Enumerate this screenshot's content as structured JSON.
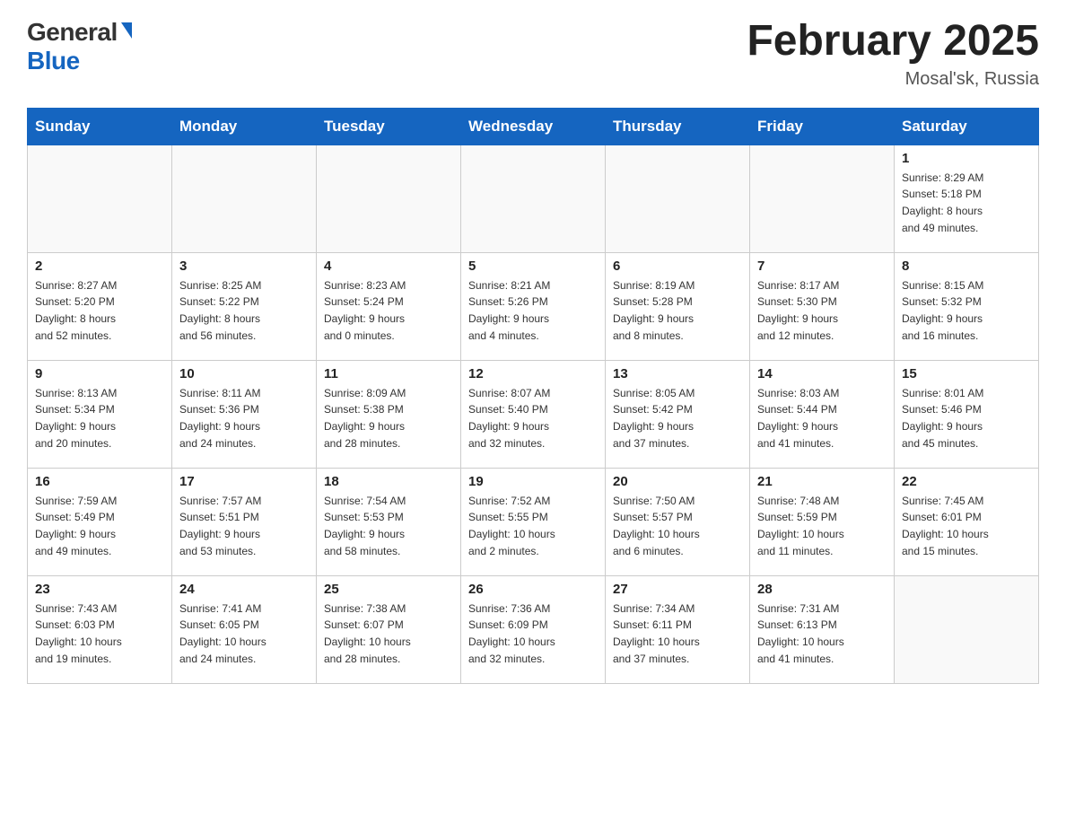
{
  "header": {
    "logo_general": "General",
    "logo_blue": "Blue",
    "title": "February 2025",
    "location": "Mosal'sk, Russia"
  },
  "days_of_week": [
    "Sunday",
    "Monday",
    "Tuesday",
    "Wednesday",
    "Thursday",
    "Friday",
    "Saturday"
  ],
  "weeks": [
    [
      {
        "day": "",
        "info": ""
      },
      {
        "day": "",
        "info": ""
      },
      {
        "day": "",
        "info": ""
      },
      {
        "day": "",
        "info": ""
      },
      {
        "day": "",
        "info": ""
      },
      {
        "day": "",
        "info": ""
      },
      {
        "day": "1",
        "info": "Sunrise: 8:29 AM\nSunset: 5:18 PM\nDaylight: 8 hours\nand 49 minutes."
      }
    ],
    [
      {
        "day": "2",
        "info": "Sunrise: 8:27 AM\nSunset: 5:20 PM\nDaylight: 8 hours\nand 52 minutes."
      },
      {
        "day": "3",
        "info": "Sunrise: 8:25 AM\nSunset: 5:22 PM\nDaylight: 8 hours\nand 56 minutes."
      },
      {
        "day": "4",
        "info": "Sunrise: 8:23 AM\nSunset: 5:24 PM\nDaylight: 9 hours\nand 0 minutes."
      },
      {
        "day": "5",
        "info": "Sunrise: 8:21 AM\nSunset: 5:26 PM\nDaylight: 9 hours\nand 4 minutes."
      },
      {
        "day": "6",
        "info": "Sunrise: 8:19 AM\nSunset: 5:28 PM\nDaylight: 9 hours\nand 8 minutes."
      },
      {
        "day": "7",
        "info": "Sunrise: 8:17 AM\nSunset: 5:30 PM\nDaylight: 9 hours\nand 12 minutes."
      },
      {
        "day": "8",
        "info": "Sunrise: 8:15 AM\nSunset: 5:32 PM\nDaylight: 9 hours\nand 16 minutes."
      }
    ],
    [
      {
        "day": "9",
        "info": "Sunrise: 8:13 AM\nSunset: 5:34 PM\nDaylight: 9 hours\nand 20 minutes."
      },
      {
        "day": "10",
        "info": "Sunrise: 8:11 AM\nSunset: 5:36 PM\nDaylight: 9 hours\nand 24 minutes."
      },
      {
        "day": "11",
        "info": "Sunrise: 8:09 AM\nSunset: 5:38 PM\nDaylight: 9 hours\nand 28 minutes."
      },
      {
        "day": "12",
        "info": "Sunrise: 8:07 AM\nSunset: 5:40 PM\nDaylight: 9 hours\nand 32 minutes."
      },
      {
        "day": "13",
        "info": "Sunrise: 8:05 AM\nSunset: 5:42 PM\nDaylight: 9 hours\nand 37 minutes."
      },
      {
        "day": "14",
        "info": "Sunrise: 8:03 AM\nSunset: 5:44 PM\nDaylight: 9 hours\nand 41 minutes."
      },
      {
        "day": "15",
        "info": "Sunrise: 8:01 AM\nSunset: 5:46 PM\nDaylight: 9 hours\nand 45 minutes."
      }
    ],
    [
      {
        "day": "16",
        "info": "Sunrise: 7:59 AM\nSunset: 5:49 PM\nDaylight: 9 hours\nand 49 minutes."
      },
      {
        "day": "17",
        "info": "Sunrise: 7:57 AM\nSunset: 5:51 PM\nDaylight: 9 hours\nand 53 minutes."
      },
      {
        "day": "18",
        "info": "Sunrise: 7:54 AM\nSunset: 5:53 PM\nDaylight: 9 hours\nand 58 minutes."
      },
      {
        "day": "19",
        "info": "Sunrise: 7:52 AM\nSunset: 5:55 PM\nDaylight: 10 hours\nand 2 minutes."
      },
      {
        "day": "20",
        "info": "Sunrise: 7:50 AM\nSunset: 5:57 PM\nDaylight: 10 hours\nand 6 minutes."
      },
      {
        "day": "21",
        "info": "Sunrise: 7:48 AM\nSunset: 5:59 PM\nDaylight: 10 hours\nand 11 minutes."
      },
      {
        "day": "22",
        "info": "Sunrise: 7:45 AM\nSunset: 6:01 PM\nDaylight: 10 hours\nand 15 minutes."
      }
    ],
    [
      {
        "day": "23",
        "info": "Sunrise: 7:43 AM\nSunset: 6:03 PM\nDaylight: 10 hours\nand 19 minutes."
      },
      {
        "day": "24",
        "info": "Sunrise: 7:41 AM\nSunset: 6:05 PM\nDaylight: 10 hours\nand 24 minutes."
      },
      {
        "day": "25",
        "info": "Sunrise: 7:38 AM\nSunset: 6:07 PM\nDaylight: 10 hours\nand 28 minutes."
      },
      {
        "day": "26",
        "info": "Sunrise: 7:36 AM\nSunset: 6:09 PM\nDaylight: 10 hours\nand 32 minutes."
      },
      {
        "day": "27",
        "info": "Sunrise: 7:34 AM\nSunset: 6:11 PM\nDaylight: 10 hours\nand 37 minutes."
      },
      {
        "day": "28",
        "info": "Sunrise: 7:31 AM\nSunset: 6:13 PM\nDaylight: 10 hours\nand 41 minutes."
      },
      {
        "day": "",
        "info": ""
      }
    ]
  ]
}
